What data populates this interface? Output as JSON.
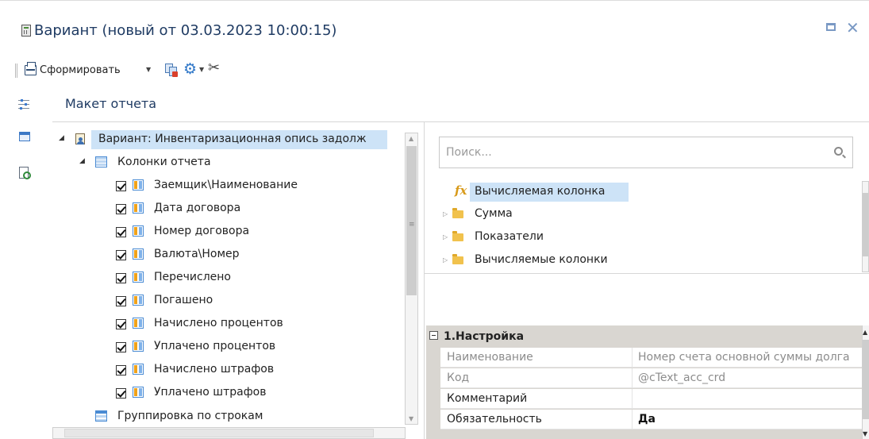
{
  "window": {
    "title": "Вариант (новый от 03.03.2023 10:00:15)",
    "restore_icon": "restore-icon",
    "close_icon": "close-icon",
    "close_glyph": "✕"
  },
  "toolbar": {
    "generate_label": "Сформировать",
    "dropdown_glyph": "▼",
    "gear_glyph": "⚙",
    "tools_glyph": "✂",
    "icons": [
      "printer-icon",
      "copy-report-icon",
      "settings-gear-icon",
      "tools-icon"
    ]
  },
  "section": {
    "title": "Макет отчета"
  },
  "tree": {
    "root": {
      "label": "Вариант: Инвентаризационная опись задолж",
      "expander": "◢"
    },
    "columns_group": {
      "label": "Колонки отчета",
      "expander": "◢"
    },
    "columns": [
      {
        "label": "Заемщик\\Наименование",
        "checked": true
      },
      {
        "label": "Дата договора",
        "checked": true
      },
      {
        "label": "Номер договора",
        "checked": true
      },
      {
        "label": "Валюта\\Номер",
        "checked": true
      },
      {
        "label": "Перечислено",
        "checked": true
      },
      {
        "label": "Погашено",
        "checked": true
      },
      {
        "label": "Начислено процентов",
        "checked": true
      },
      {
        "label": "Уплачено процентов",
        "checked": true
      },
      {
        "label": "Начислено штрафов",
        "checked": true
      },
      {
        "label": "Уплачено штрафов",
        "checked": true
      }
    ],
    "row_grouping": {
      "label": "Группировка по строкам"
    }
  },
  "search": {
    "placeholder": "Поиск..."
  },
  "fields": {
    "calculated_column": "Вычисляемая колонка",
    "folders": [
      {
        "label": "Сумма"
      },
      {
        "label": "Показатели"
      },
      {
        "label": "Вычисляемые колонки"
      }
    ],
    "expander": "▷",
    "fx_glyph": "fx"
  },
  "properties": {
    "category": "1.Настройка",
    "rows": [
      {
        "name": "Наименование",
        "value": "Номер счета основной суммы долга",
        "readonly": true
      },
      {
        "name": "Код",
        "value": "@cText_acc_crd",
        "readonly": true
      },
      {
        "name": "Комментарий",
        "value": "",
        "readonly": false
      },
      {
        "name": "Обязательность",
        "value": "Да",
        "readonly": false
      }
    ]
  },
  "colors": {
    "title": "#1f3b63",
    "selection": "#cde3f7",
    "accent": "#3c78c5",
    "property_category_bg": "#d9d6d1"
  }
}
